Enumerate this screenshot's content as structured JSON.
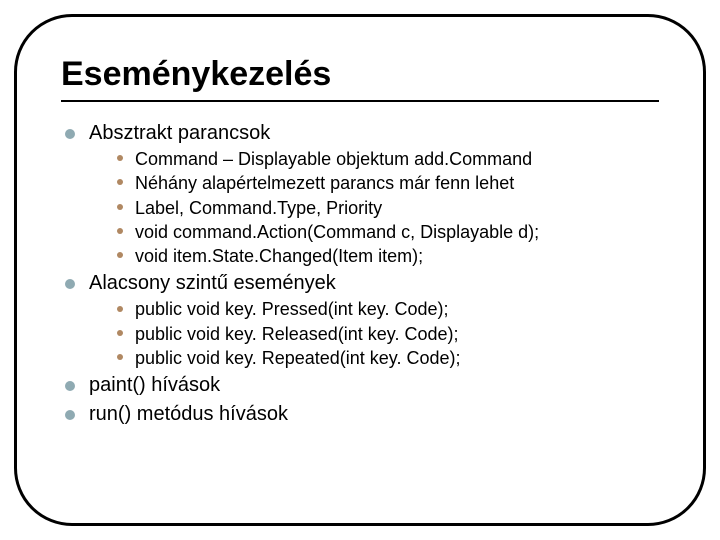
{
  "title": "Eseménykezelés",
  "items": [
    {
      "label": "Absztrakt parancsok",
      "sub": [
        "Command – Displayable objektum add.Command",
        "Néhány alapértelmezett parancs már fenn lehet",
        "Label, Command.Type, Priority",
        "void command.Action(Command c, Displayable d);",
        "void item.State.Changed(Item item);"
      ]
    },
    {
      "label": "Alacsony szintű események",
      "sub": [
        "public void key. Pressed(int key. Code);",
        "public void key. Released(int key. Code);",
        "public void key. Repeated(int key. Code);"
      ]
    },
    {
      "label": "paint() hívások",
      "sub": []
    },
    {
      "label": "run() metódus hívások",
      "sub": []
    }
  ]
}
